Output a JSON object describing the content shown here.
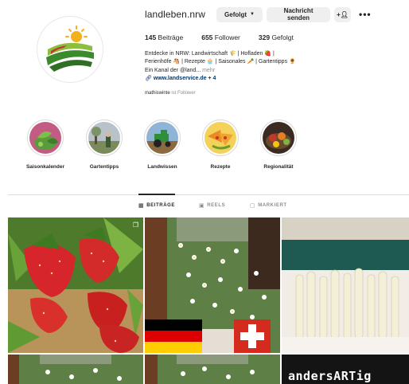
{
  "profile": {
    "username": "landleben.nrw",
    "follow_label": "Gefolgt",
    "message_label": "Nachricht senden",
    "suggest_label": "+A",
    "more_label": "•••"
  },
  "stats": {
    "posts_count": "145",
    "posts_label": " Beiträge",
    "followers_count": "655",
    "followers_label": " Follower",
    "following_count": "329",
    "following_label": " Gefolgt"
  },
  "bio": {
    "line1": "Entdecke in NRW: Landwirtschaft 🌾 | Hofladen 🍓 |",
    "line2": "Ferienhöfe 🐴 | Rezepte 🧁 | Saisonales 🥕 | Gartentipps 🌻",
    "line3_text": "Ein Kanal der @land...",
    "line3_more": " mehr",
    "link_text": "www.landservice.de + 4"
  },
  "followed_by": {
    "name": "mathiswinte",
    "suffix": " ist Follower"
  },
  "highlights": [
    {
      "label": "Saisonkalender",
      "icon": "leaf-bowl-icon"
    },
    {
      "label": "Gartentipps",
      "icon": "garden-photo-icon"
    },
    {
      "label": "Landwissen",
      "icon": "tractor-icon"
    },
    {
      "label": "Rezepte",
      "icon": "food-plate-icon"
    },
    {
      "label": "Regionalität",
      "icon": "produce-basket-icon"
    }
  ],
  "tabs": [
    {
      "label": "BEITRÄGE",
      "icon": "grid-icon",
      "active": true
    },
    {
      "label": "REELS",
      "icon": "reels-icon",
      "active": false
    },
    {
      "label": "MARKIERT",
      "icon": "tagged-icon",
      "active": false
    }
  ],
  "posts": [
    {
      "name": "post-strawberries",
      "text": ""
    },
    {
      "name": "post-daisies-flags",
      "text": ""
    },
    {
      "name": "post-white-asparagus",
      "text": ""
    },
    {
      "name": "post-daisies-row2a",
      "text": ""
    },
    {
      "name": "post-daisies-row2b",
      "text": ""
    },
    {
      "name": "post-andersartig",
      "text": "andersARTig"
    }
  ],
  "colors": {
    "button_bg": "#efefef",
    "text": "#262626",
    "muted": "#8e8e8e",
    "link": "#00376b",
    "divider": "#dbdbdb"
  }
}
